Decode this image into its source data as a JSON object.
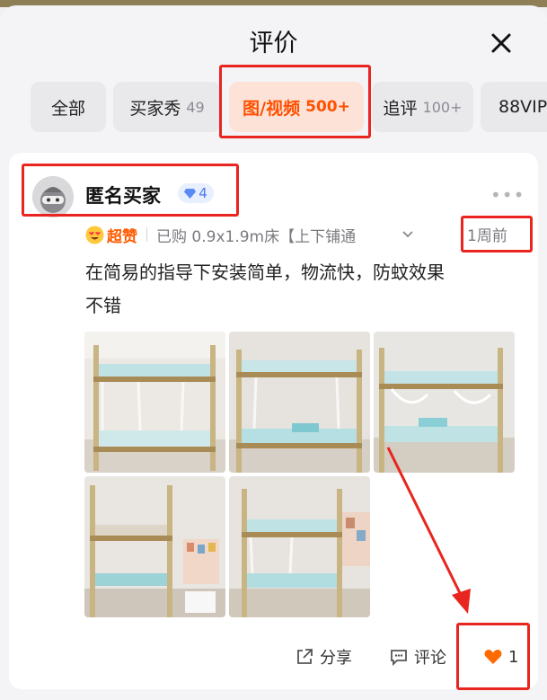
{
  "header": {
    "title": "评价"
  },
  "tabs": [
    {
      "label": "全部",
      "count": ""
    },
    {
      "label": "买家秀",
      "count": "49"
    },
    {
      "label": "图/视频",
      "count": "500+"
    },
    {
      "label": "追评",
      "count": "100+"
    },
    {
      "label": "88VIP",
      "count": ""
    }
  ],
  "review": {
    "user_name": "匿名买家",
    "level": "4",
    "rating_label": "超赞",
    "purchase_info": "已购 0.9x1.9m床【上下铺通",
    "time_ago": "1周前",
    "text_line1": "在简易的指导下安装简单，物流快，防蚊效果",
    "text_line2": "不错",
    "photo_count": 5
  },
  "actions": {
    "share_label": "分享",
    "comment_label": "评论",
    "like_count": "1"
  },
  "colors": {
    "accent": "#ff5000",
    "highlight": "#e8251f",
    "like": "#ff6a00"
  },
  "icons": [
    "close-icon",
    "diamond-icon",
    "more-icon",
    "emoji-heart-eyes-icon",
    "chevron-down-icon",
    "share-icon",
    "comment-icon",
    "heart-icon"
  ]
}
